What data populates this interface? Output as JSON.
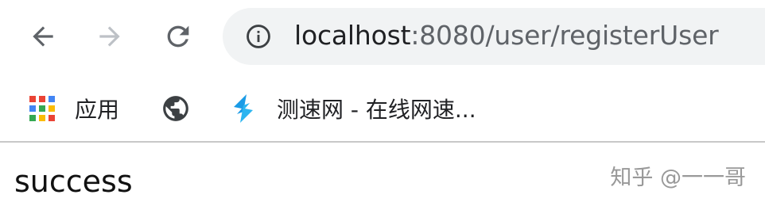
{
  "toolbar": {
    "back_icon": "back-arrow-icon",
    "forward_icon": "forward-arrow-icon",
    "reload_icon": "reload-icon",
    "address_bar": {
      "info_icon": "info-icon",
      "host": "localhost",
      "path": ":8080/user/registerUser"
    }
  },
  "bookmarks": {
    "items": [
      {
        "icon": "apps-grid-icon",
        "label": "应用"
      },
      {
        "icon": "globe-icon",
        "label": ""
      },
      {
        "icon": "speedtest-logo-icon",
        "label": "测速网 - 在线网速..."
      }
    ]
  },
  "page": {
    "body_text": "success"
  },
  "watermark": "知乎 @一一哥",
  "colors": {
    "omnibox_bg": "#f1f3f4",
    "icon_gray": "#5f6368",
    "icon_disabled": "#bdc1c6",
    "speedtest_blue": "#1a9be6",
    "watermark": "#999999"
  }
}
